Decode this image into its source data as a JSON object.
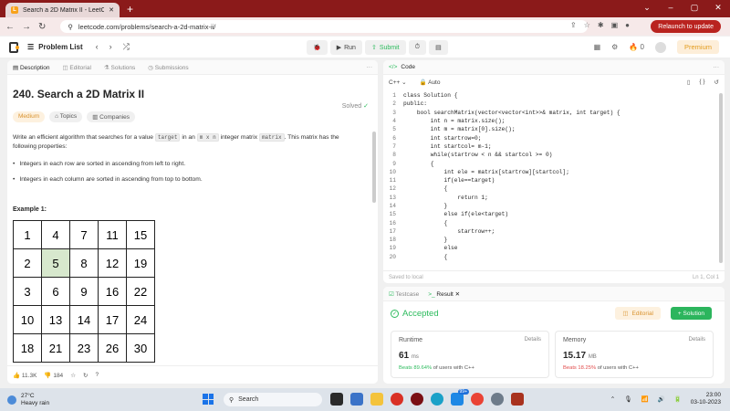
{
  "browser": {
    "tab_title": "Search a 2D Matrix II - LeetCode",
    "url": "leetcode.com/problems/search-a-2d-matrix-ii/",
    "relaunch_label": "Relaunch to update"
  },
  "topbar": {
    "problem_list_label": "Problem List",
    "run_label": "Run",
    "submit_label": "Submit",
    "fire_count": "0",
    "premium_label": "Premium"
  },
  "left_tabs": [
    "Description",
    "Editorial",
    "Solutions",
    "Submissions"
  ],
  "problem": {
    "title": "240. Search a 2D Matrix II",
    "status": "Solved",
    "difficulty": "Medium",
    "chips": [
      "Topics",
      "Companies"
    ],
    "desc_pre": "Write an efficient algorithm that searches for a value ",
    "desc_code1": "target",
    "desc_mid1": " in an ",
    "desc_code2": "m x n",
    "desc_mid2": " integer matrix ",
    "desc_code3": "matrix",
    "desc_post": ". This matrix has the following properties:",
    "bullets": [
      "Integers in each row are sorted in ascending from left to right.",
      "Integers in each column are sorted in ascending from top to bottom."
    ],
    "example_label": "Example 1:",
    "matrix": [
      [
        "1",
        "4",
        "7",
        "11",
        "15"
      ],
      [
        "2",
        "5",
        "8",
        "12",
        "19"
      ],
      [
        "3",
        "6",
        "9",
        "16",
        "22"
      ],
      [
        "10",
        "13",
        "14",
        "17",
        "24"
      ],
      [
        "18",
        "21",
        "23",
        "26",
        "30"
      ]
    ],
    "likes": "11.3K",
    "dislikes": "184"
  },
  "code_panel": {
    "title": "Code",
    "language": "C++",
    "mode": "Auto",
    "lines": [
      "class Solution {",
      "public:",
      "    bool searchMatrix(vector<vector<int>>& matrix, int target) {",
      "        int n = matrix.size();",
      "        int m = matrix[0].size();",
      "        int startrow=0;",
      "        int startcol= m-1;",
      "        while(startrow < n && startcol >= 0)",
      "        {",
      "            int ele = matrix[startrow][startcol];",
      "            if(ele==target)",
      "            {",
      "                return 1;",
      "            }",
      "            else if(ele<target)",
      "            {",
      "                startrow++;",
      "            }",
      "            else",
      "            {"
    ],
    "saved_label": "Saved to local",
    "cursor_pos": "Ln 1, Col 1"
  },
  "result_panel": {
    "tab_testcase": "Testcase",
    "tab_result": "Result",
    "status": "Accepted",
    "editorial_label": "Editorial",
    "solution_label": "+ Solution",
    "runtime": {
      "label": "Runtime",
      "value": "61",
      "unit": "ms",
      "beats": "Beats 89.64%",
      "suffix": "of users with C++",
      "details": "Details"
    },
    "memory": {
      "label": "Memory",
      "value": "15.17",
      "unit": "MB",
      "beats": "Beats 18.25%",
      "suffix": "of users with C++",
      "details": "Details"
    }
  },
  "taskbar": {
    "temp": "27°C",
    "weather": "Heavy rain",
    "search_label": "Search",
    "time": "23:00",
    "date": "03-10-2023",
    "badge": "99+"
  },
  "colors": {
    "accent_green": "#2cbb5d",
    "brand_orange": "#f8a21b",
    "window_red": "#8b1a1a"
  }
}
